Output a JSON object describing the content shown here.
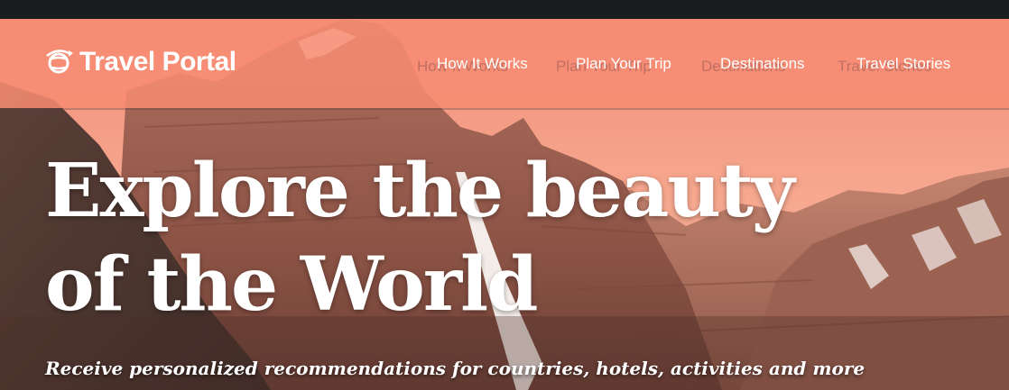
{
  "brand": {
    "name": "Travel Portal",
    "icon": "globe-icon"
  },
  "nav": {
    "items": [
      {
        "label": "How It Works"
      },
      {
        "label": "Plan Your Trip"
      },
      {
        "label": "Destinations"
      },
      {
        "label": "Travel Stories"
      }
    ],
    "ghost_items": [
      {
        "label": "How It Works"
      },
      {
        "label": "Plan Your Trip"
      },
      {
        "label": "Destinations"
      },
      {
        "label": "Travel Stories"
      }
    ]
  },
  "hero": {
    "headline": "Explore the beauty of the World",
    "tagline": "Receive personalized recommendations for countries, hotels, activities and more"
  },
  "colors": {
    "navbar": "#f78c72",
    "topbar": "#1b1c1f",
    "text": "#ffffff"
  }
}
